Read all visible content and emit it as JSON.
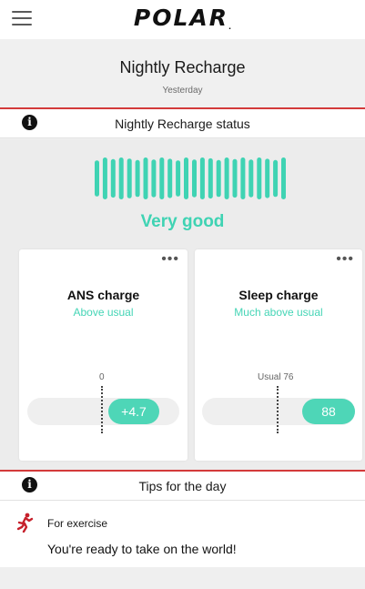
{
  "app": {
    "logo_text": "POLAR",
    "logo_mark": "."
  },
  "header": {
    "title": "Nightly Recharge",
    "subtitle": "Yesterday"
  },
  "status_section": {
    "label": "Nightly Recharge status",
    "status": "Very good",
    "bar_count": 24,
    "bar_color": "#3fd3b3"
  },
  "ans_card": {
    "title": "ANS charge",
    "subtitle": "Above usual",
    "reference": "0",
    "value": "+4.7"
  },
  "sleep_card": {
    "title": "Sleep charge",
    "subtitle": "Much above usual",
    "reference": "Usual 76",
    "value": "88"
  },
  "tips_section": {
    "label": "Tips for the day",
    "category": "For exercise",
    "message": "You're ready to take on the world!"
  },
  "colors": {
    "accent": "#3fd3b3",
    "divider": "#d33a3a",
    "icon": "#c6202b"
  }
}
